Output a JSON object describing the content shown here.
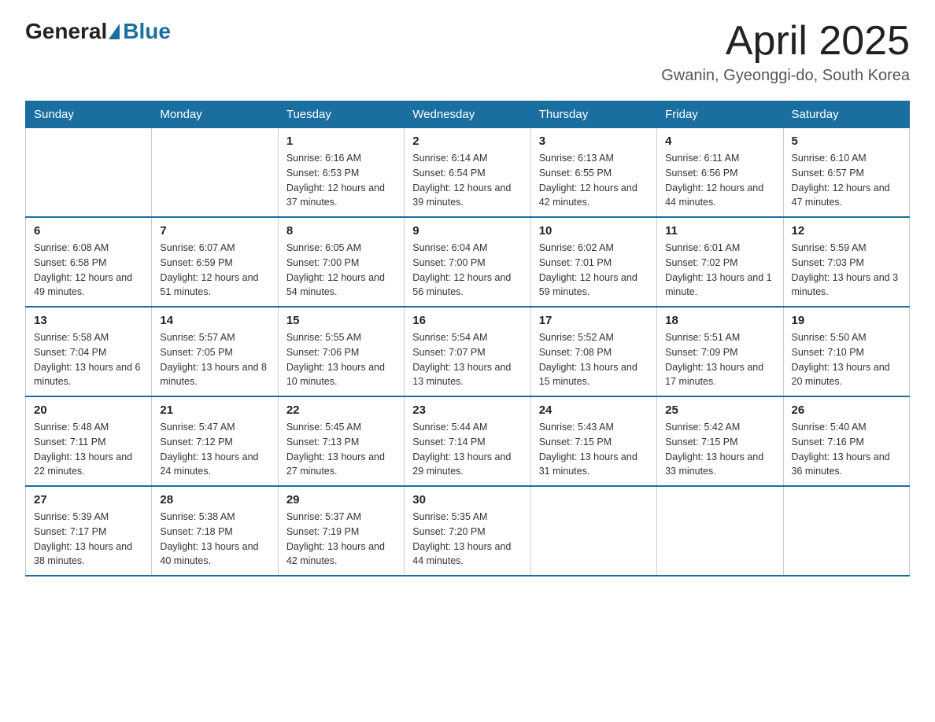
{
  "header": {
    "logo_general": "General",
    "logo_blue": "Blue",
    "month_title": "April 2025",
    "location": "Gwanin, Gyeonggi-do, South Korea"
  },
  "days_of_week": [
    "Sunday",
    "Monday",
    "Tuesday",
    "Wednesday",
    "Thursday",
    "Friday",
    "Saturday"
  ],
  "weeks": [
    [
      null,
      null,
      {
        "day": "1",
        "sunrise": "6:16 AM",
        "sunset": "6:53 PM",
        "daylight": "12 hours and 37 minutes."
      },
      {
        "day": "2",
        "sunrise": "6:14 AM",
        "sunset": "6:54 PM",
        "daylight": "12 hours and 39 minutes."
      },
      {
        "day": "3",
        "sunrise": "6:13 AM",
        "sunset": "6:55 PM",
        "daylight": "12 hours and 42 minutes."
      },
      {
        "day": "4",
        "sunrise": "6:11 AM",
        "sunset": "6:56 PM",
        "daylight": "12 hours and 44 minutes."
      },
      {
        "day": "5",
        "sunrise": "6:10 AM",
        "sunset": "6:57 PM",
        "daylight": "12 hours and 47 minutes."
      }
    ],
    [
      {
        "day": "6",
        "sunrise": "6:08 AM",
        "sunset": "6:58 PM",
        "daylight": "12 hours and 49 minutes."
      },
      {
        "day": "7",
        "sunrise": "6:07 AM",
        "sunset": "6:59 PM",
        "daylight": "12 hours and 51 minutes."
      },
      {
        "day": "8",
        "sunrise": "6:05 AM",
        "sunset": "7:00 PM",
        "daylight": "12 hours and 54 minutes."
      },
      {
        "day": "9",
        "sunrise": "6:04 AM",
        "sunset": "7:00 PM",
        "daylight": "12 hours and 56 minutes."
      },
      {
        "day": "10",
        "sunrise": "6:02 AM",
        "sunset": "7:01 PM",
        "daylight": "12 hours and 59 minutes."
      },
      {
        "day": "11",
        "sunrise": "6:01 AM",
        "sunset": "7:02 PM",
        "daylight": "13 hours and 1 minute."
      },
      {
        "day": "12",
        "sunrise": "5:59 AM",
        "sunset": "7:03 PM",
        "daylight": "13 hours and 3 minutes."
      }
    ],
    [
      {
        "day": "13",
        "sunrise": "5:58 AM",
        "sunset": "7:04 PM",
        "daylight": "13 hours and 6 minutes."
      },
      {
        "day": "14",
        "sunrise": "5:57 AM",
        "sunset": "7:05 PM",
        "daylight": "13 hours and 8 minutes."
      },
      {
        "day": "15",
        "sunrise": "5:55 AM",
        "sunset": "7:06 PM",
        "daylight": "13 hours and 10 minutes."
      },
      {
        "day": "16",
        "sunrise": "5:54 AM",
        "sunset": "7:07 PM",
        "daylight": "13 hours and 13 minutes."
      },
      {
        "day": "17",
        "sunrise": "5:52 AM",
        "sunset": "7:08 PM",
        "daylight": "13 hours and 15 minutes."
      },
      {
        "day": "18",
        "sunrise": "5:51 AM",
        "sunset": "7:09 PM",
        "daylight": "13 hours and 17 minutes."
      },
      {
        "day": "19",
        "sunrise": "5:50 AM",
        "sunset": "7:10 PM",
        "daylight": "13 hours and 20 minutes."
      }
    ],
    [
      {
        "day": "20",
        "sunrise": "5:48 AM",
        "sunset": "7:11 PM",
        "daylight": "13 hours and 22 minutes."
      },
      {
        "day": "21",
        "sunrise": "5:47 AM",
        "sunset": "7:12 PM",
        "daylight": "13 hours and 24 minutes."
      },
      {
        "day": "22",
        "sunrise": "5:45 AM",
        "sunset": "7:13 PM",
        "daylight": "13 hours and 27 minutes."
      },
      {
        "day": "23",
        "sunrise": "5:44 AM",
        "sunset": "7:14 PM",
        "daylight": "13 hours and 29 minutes."
      },
      {
        "day": "24",
        "sunrise": "5:43 AM",
        "sunset": "7:15 PM",
        "daylight": "13 hours and 31 minutes."
      },
      {
        "day": "25",
        "sunrise": "5:42 AM",
        "sunset": "7:15 PM",
        "daylight": "13 hours and 33 minutes."
      },
      {
        "day": "26",
        "sunrise": "5:40 AM",
        "sunset": "7:16 PM",
        "daylight": "13 hours and 36 minutes."
      }
    ],
    [
      {
        "day": "27",
        "sunrise": "5:39 AM",
        "sunset": "7:17 PM",
        "daylight": "13 hours and 38 minutes."
      },
      {
        "day": "28",
        "sunrise": "5:38 AM",
        "sunset": "7:18 PM",
        "daylight": "13 hours and 40 minutes."
      },
      {
        "day": "29",
        "sunrise": "5:37 AM",
        "sunset": "7:19 PM",
        "daylight": "13 hours and 42 minutes."
      },
      {
        "day": "30",
        "sunrise": "5:35 AM",
        "sunset": "7:20 PM",
        "daylight": "13 hours and 44 minutes."
      },
      null,
      null,
      null
    ]
  ]
}
